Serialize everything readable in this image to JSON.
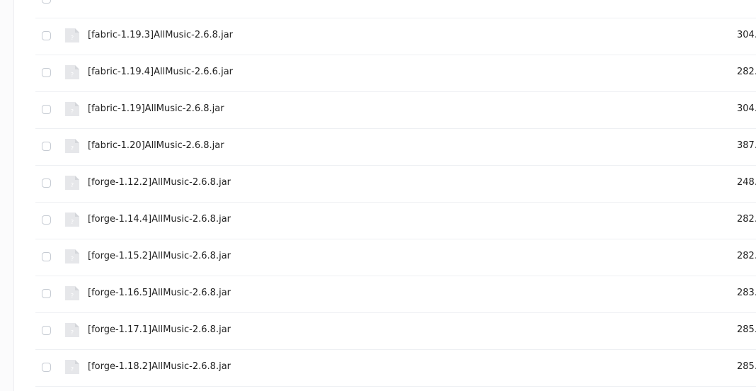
{
  "files": [
    {
      "name": "[fabric-1.19.3]AllMusic-2.6.8.jar",
      "size": "304."
    },
    {
      "name": "[fabric-1.19.4]AllMusic-2.6.6.jar",
      "size": "282."
    },
    {
      "name": "[fabric-1.19]AllMusic-2.6.8.jar",
      "size": "304."
    },
    {
      "name": "[fabric-1.20]AllMusic-2.6.8.jar",
      "size": "387."
    },
    {
      "name": "[forge-1.12.2]AllMusic-2.6.8.jar",
      "size": "248."
    },
    {
      "name": "[forge-1.14.4]AllMusic-2.6.8.jar",
      "size": "282."
    },
    {
      "name": "[forge-1.15.2]AllMusic-2.6.8.jar",
      "size": "282."
    },
    {
      "name": "[forge-1.16.5]AllMusic-2.6.8.jar",
      "size": "283."
    },
    {
      "name": "[forge-1.17.1]AllMusic-2.6.8.jar",
      "size": "285."
    },
    {
      "name": "[forge-1.18.2]AllMusic-2.6.8.jar",
      "size": "285."
    }
  ],
  "icons": {
    "file": "unknown-file-icon"
  },
  "colors": {
    "row_divider": "#eef0f3",
    "file_icon": "#e6e7ea",
    "text": "#222222"
  }
}
